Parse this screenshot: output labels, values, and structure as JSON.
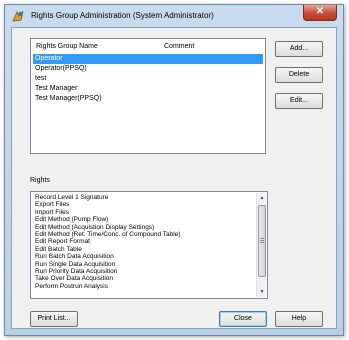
{
  "window": {
    "title": "Rights Group Administration (System Administrator)",
    "close_glyph": "✕"
  },
  "groups": {
    "headers": {
      "name": "Rights Group Name",
      "comment": "Comment"
    },
    "rows": [
      {
        "name": "Operator",
        "selected": true
      },
      {
        "name": "Operator(PPSQ)",
        "selected": false
      },
      {
        "name": "test",
        "selected": false
      },
      {
        "name": "Test Manager",
        "selected": false
      },
      {
        "name": "Test Manager(PPSQ)",
        "selected": false
      }
    ]
  },
  "buttons": {
    "add": "Add...",
    "delete": "Delete",
    "edit": "Edit...",
    "print_list": "Print List...",
    "close": "Close",
    "help": "Help"
  },
  "rights": {
    "label": "Rights",
    "items": [
      "Record Level 1 Signature",
      "Export Files",
      "Import Files",
      "Edit Method (Pump Flow)",
      "Edit Method (Acquistion Display Settings)",
      "Edit Method (Ret. Time/Conc. of Compound Table)",
      "Edit Report Format",
      "Edit Batch Table",
      "Run Batch Data Acquisition",
      "Run Single Data Acquisition",
      "Run Priority Data Acquisition",
      "Take Over Data Acquisition",
      "Perform Postrun Analysis"
    ],
    "scroll_up_glyph": "▲",
    "scroll_down_glyph": "▼"
  },
  "colors": {
    "selection": "#3399ff",
    "title_bar": "#c9dcef",
    "close_button": "#c74a32"
  }
}
